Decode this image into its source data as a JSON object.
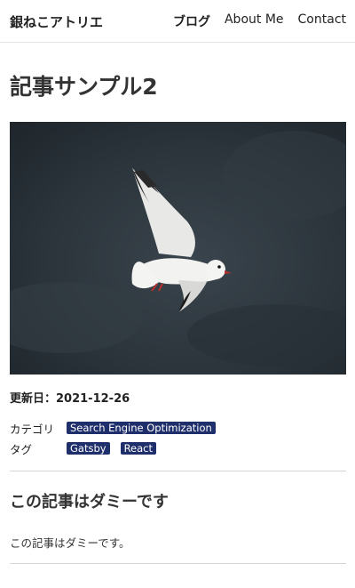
{
  "header": {
    "site_title": "銀ねこアトリエ",
    "nav": [
      {
        "label": "ブログ"
      },
      {
        "label": "About Me"
      },
      {
        "label": "Contact"
      }
    ]
  },
  "article": {
    "title": "記事サンプル2",
    "hero_image": {
      "subject": "seagull-in-flight",
      "background_color": "#2a3238"
    },
    "updated": "更新日：2021-12-26",
    "category_label": "カテゴリ",
    "categories": [
      "Search Engine Optimization"
    ],
    "tag_label": "タグ",
    "tags": [
      "Gatsby",
      "React"
    ],
    "section_heading": "この記事はダミーです",
    "body": "この記事はダミーです。"
  },
  "colors": {
    "chip_bg": "#1f2f6b",
    "chip_text": "#ffffff",
    "divider": "#d6d6d6"
  }
}
